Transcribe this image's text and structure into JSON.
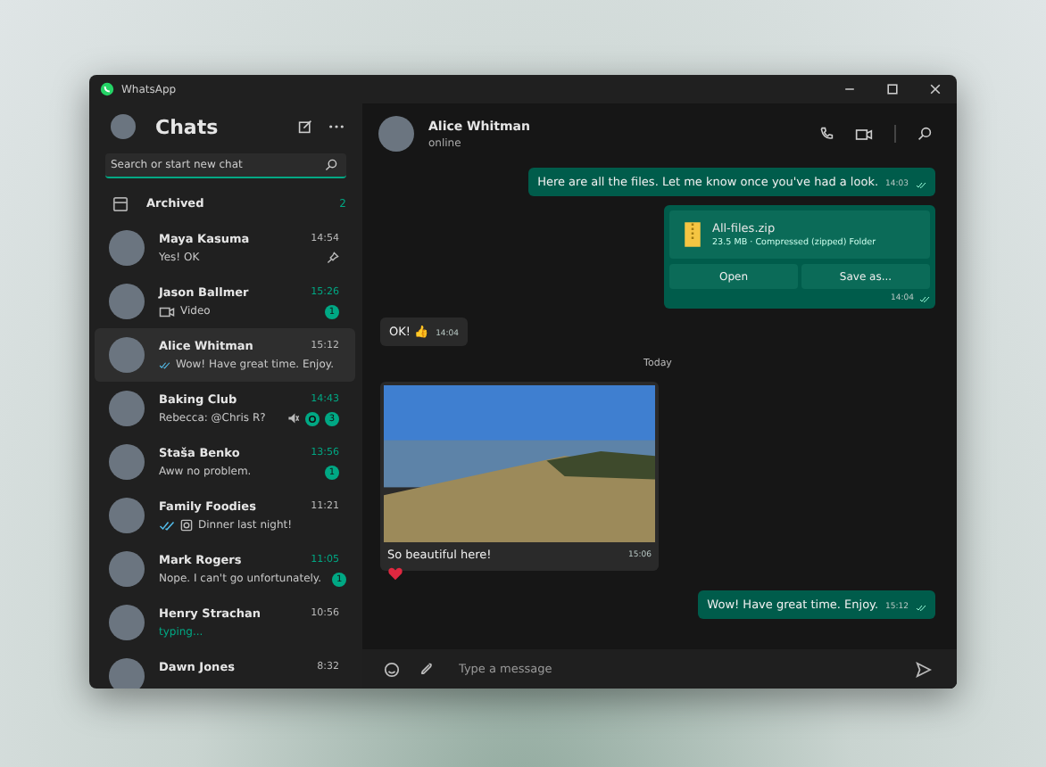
{
  "window": {
    "title": "WhatsApp"
  },
  "sidebar": {
    "title": "Chats",
    "search": {
      "placeholder": "Search or start new chat"
    },
    "archived": {
      "label": "Archived",
      "count": "2"
    },
    "chats": [
      {
        "name": "Maya Kasuma",
        "time": "14:54",
        "preview": "Yes! OK",
        "kind": "text",
        "read_ticks": false,
        "pinned": true,
        "muted": false,
        "mention": false,
        "selected": false
      },
      {
        "name": "Jason Ballmer",
        "time": "15:26",
        "preview": "Video",
        "kind": "video",
        "read_ticks": false,
        "badge": "1",
        "pinned": false,
        "muted": false,
        "mention": false,
        "selected": false
      },
      {
        "name": "Alice Whitman",
        "time": "15:12",
        "preview": "Wow! Have great time. Enjoy.",
        "kind": "text",
        "read_ticks": true,
        "pinned": false,
        "muted": false,
        "mention": false,
        "selected": true
      },
      {
        "name": "Baking Club",
        "time": "14:43",
        "preview": "Rebecca: @Chris R?",
        "kind": "text",
        "read_ticks": false,
        "badge": "3",
        "pinned": false,
        "muted": true,
        "mention": true,
        "selected": false
      },
      {
        "name": "Staša Benko",
        "time": "13:56",
        "preview": "Aww no problem.",
        "kind": "text",
        "read_ticks": false,
        "badge": "1",
        "pinned": false,
        "muted": false,
        "mention": false,
        "selected": false
      },
      {
        "name": "Family Foodies",
        "time": "11:21",
        "preview": "Dinner last night!",
        "kind": "photo",
        "read_ticks": true,
        "pinned": false,
        "muted": false,
        "mention": false,
        "selected": false
      },
      {
        "name": "Mark Rogers",
        "time": "11:05",
        "preview": "Nope. I can't go unfortunately.",
        "kind": "text",
        "read_ticks": false,
        "badge": "1",
        "pinned": false,
        "muted": false,
        "mention": false,
        "selected": false
      },
      {
        "name": "Henry Strachan",
        "time": "10:56",
        "preview": "typing...",
        "kind": "typing",
        "read_ticks": false,
        "pinned": false,
        "muted": false,
        "mention": false,
        "selected": false
      },
      {
        "name": "Dawn Jones",
        "time": "8:32",
        "kind": "text",
        "read_ticks": false,
        "pinned": false,
        "muted": false,
        "mention": false,
        "selected": false
      }
    ]
  },
  "chat": {
    "name": "Alice Whitman",
    "status": "online",
    "messages": [
      {
        "kind": "text",
        "outgoing": true,
        "text": "Here are all the files. Let me know once you've had a look.",
        "time": "14:03",
        "read_ticks": true
      },
      {
        "kind": "file",
        "outgoing": true,
        "file_name": "All-files.zip",
        "file_meta": "23.5 MB · Compressed (zipped) Folder",
        "buttons": [
          "Open",
          "Save as..."
        ],
        "time": "14:04",
        "read_ticks": true
      },
      {
        "kind": "text",
        "outgoing": false,
        "text": "OK! 👍",
        "time": "14:04",
        "read_ticks": false
      },
      {
        "kind": "date",
        "text": "Today"
      },
      {
        "kind": "photo",
        "outgoing": false,
        "caption": "So beautiful here!",
        "time": "15:06",
        "reaction": true
      },
      {
        "kind": "text",
        "outgoing": true,
        "text": "Wow! Have great time. Enjoy.",
        "time": "15:12",
        "read_ticks": true
      }
    ],
    "composer": {
      "placeholder": "Type a message"
    }
  }
}
